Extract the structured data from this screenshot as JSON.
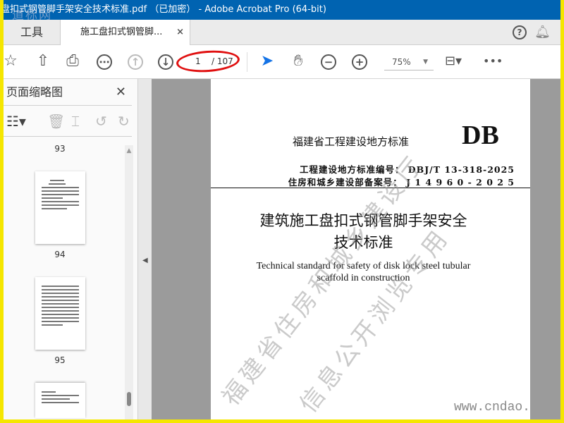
{
  "window": {
    "title": "盘扣式钢管脚手架安全技术标准.pdf （已加密） - Adobe Acrobat Pro (64-bit)",
    "watermark_logo": "道标网"
  },
  "tabs": {
    "tools": "工具",
    "document": "施工盘扣式钢管脚...",
    "close": "×"
  },
  "toolbar": {
    "current_page": "1",
    "total_pages": "/ 107",
    "zoom": "75%"
  },
  "panel": {
    "title": "页面缩略图",
    "close": "✕",
    "thumbnails": [
      {
        "label": "93"
      },
      {
        "label": "94"
      },
      {
        "label": "95"
      },
      {
        "label": ""
      }
    ]
  },
  "page": {
    "org": "福建省工程建设地方标准",
    "db": "DB",
    "std_no": "工程建设地方标准编号： DBJ/T 13-318-2025",
    "record_no": "住房和城乡建设部备案号： J 1 4 9 6 0 - 2 0 2 5",
    "title_zh_1": "建筑施工盘扣式钢管脚手架安全",
    "title_zh_2": "技术标准",
    "title_en_1": "Technical standard for safety of disk lock steel tubular",
    "title_en_2": "scaffold in construction",
    "watermark_1": "福建省住房和城乡建设厅",
    "watermark_2": "信息公开浏览专用",
    "url": "www.cndao."
  }
}
